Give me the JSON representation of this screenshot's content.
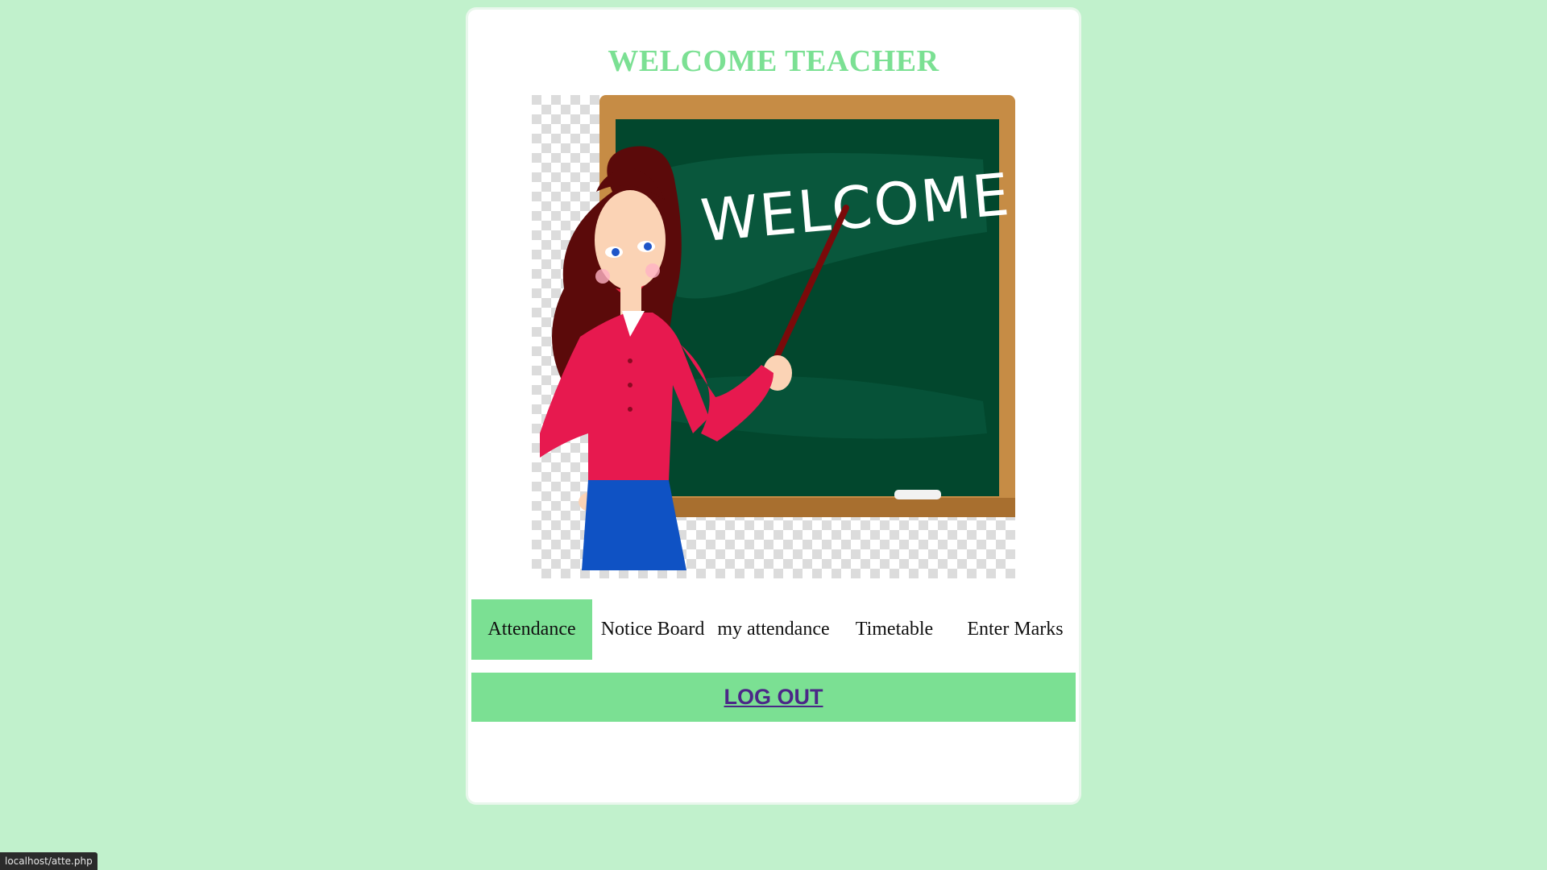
{
  "page": {
    "title": "WELCOME TEACHER"
  },
  "illustration": {
    "chalk_text": "WELCOME"
  },
  "nav": {
    "items": [
      {
        "label": "Attendance",
        "active": true
      },
      {
        "label": "Notice Board",
        "active": false
      },
      {
        "label": "my attendance",
        "active": false
      },
      {
        "label": "Timetable",
        "active": false
      },
      {
        "label": "Enter Marks",
        "active": false
      }
    ]
  },
  "logout": {
    "label": "LOG OUT"
  },
  "status_bar": {
    "url": "localhost/atte.php"
  },
  "colors": {
    "background": "#c1f1cc",
    "accent": "#7be093",
    "link": "#4b2787"
  }
}
